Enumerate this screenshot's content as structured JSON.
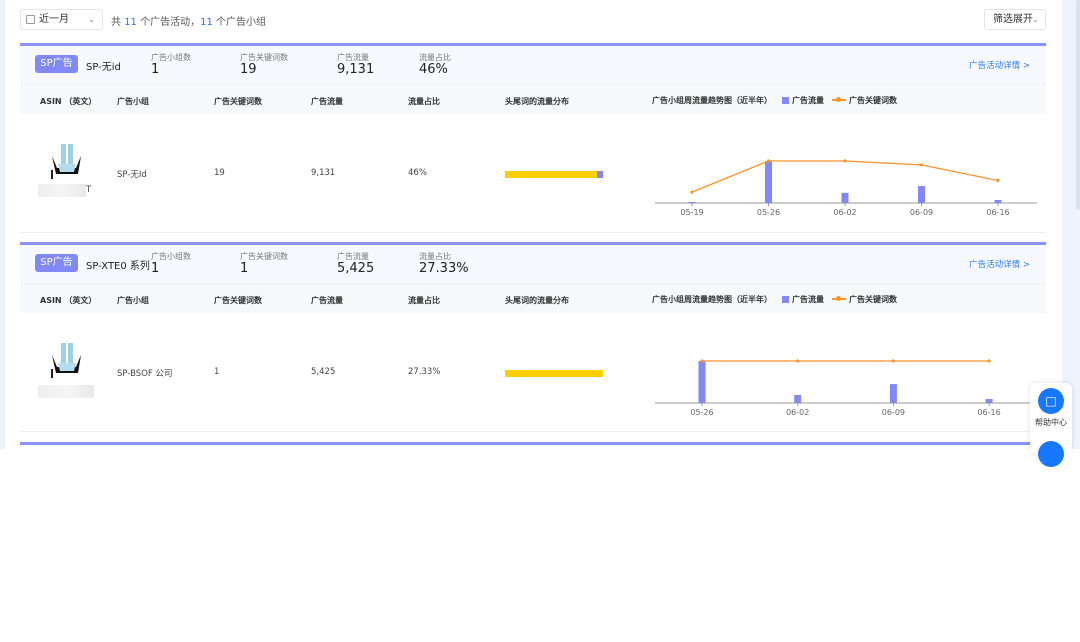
{
  "toolbar": {
    "date_range": "近一月",
    "summary_prefix": "共 ",
    "campaign_count": "11",
    "summary_mid": " 个广告活动，",
    "group_count": "11",
    "summary_suffix": " 个广告小组",
    "filter_label": "筛选展开"
  },
  "colors": {
    "accent": "#8189f6",
    "line": "#f7952f",
    "head": "#fccf00",
    "link": "#2b7cf0"
  },
  "stat_labels": {
    "groups": "广告小组数",
    "keywords": "广告关键词数",
    "traffic": "广告流量",
    "share": "流量占比"
  },
  "columns": [
    "ASIN （英文）",
    "广告小组",
    "广告关键词数",
    "广告流量",
    "流量占比",
    "头尾词的流量分布",
    "广告小组周流量趋势图（近半年）"
  ],
  "legend": {
    "bar": "广告流量",
    "line": "广告关键词数"
  },
  "detail_link": "广告活动详情 >",
  "campaigns": [
    {
      "badge": "SP广告",
      "name": "SP-无id",
      "groups": "1",
      "keywords": "19",
      "traffic": "9,131",
      "share": "46%",
      "row": {
        "asin_suffix": "T",
        "group": "SP-无Id",
        "keywords": "19",
        "traffic": "9,131",
        "share": "46%",
        "head_fraction": 0.94
      }
    },
    {
      "badge": "SP广告",
      "name": "SP-XTE0 系列",
      "groups": "1",
      "keywords": "1",
      "traffic": "5,425",
      "share": "27.33%",
      "row": {
        "asin_suffix": "",
        "group": "SP-BSOF 公司",
        "keywords": "1",
        "traffic": "5,425",
        "share": "27.33%",
        "head_fraction": 1.0
      }
    }
  ],
  "chart_data": [
    {
      "type": "bar+line",
      "x": [
        "05-19",
        "05-26",
        "06-02",
        "06-09",
        "06-16"
      ],
      "series": [
        {
          "name": "广告流量",
          "type": "bar",
          "values": [
            50,
            6200,
            1500,
            2500,
            450
          ]
        },
        {
          "name": "广告关键词数",
          "type": "line",
          "values": [
            3,
            19,
            19,
            17,
            9
          ]
        }
      ],
      "bar_max": 6200,
      "line_max": 19
    },
    {
      "type": "bar+line",
      "x": [
        "05-26",
        "06-02",
        "06-09",
        "06-16"
      ],
      "series": [
        {
          "name": "广告流量",
          "type": "bar",
          "values": [
            4000,
            760,
            1800,
            380
          ]
        },
        {
          "name": "广告关键词数",
          "type": "line",
          "values": [
            1,
            1,
            1,
            1
          ]
        }
      ],
      "bar_max": 4000,
      "line_max": 1
    }
  ],
  "help": {
    "label": "帮助中心"
  }
}
